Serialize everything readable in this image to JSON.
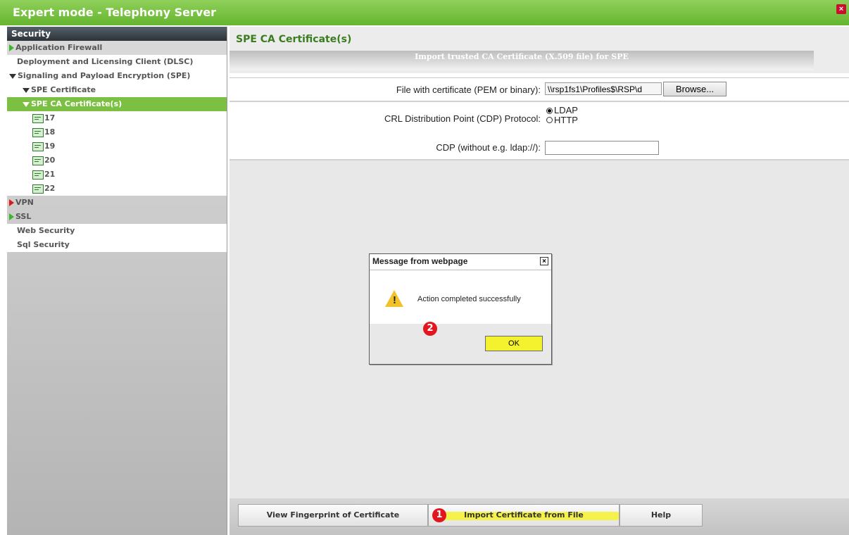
{
  "window": {
    "title": "Expert mode - Telephony Server",
    "close_glyph": "×"
  },
  "sidebar": {
    "header": "Security",
    "items": [
      {
        "label": "Application Firewall",
        "icon": "play-green-icon"
      },
      {
        "label": "Deployment and Licensing Client (DLSC)",
        "icon": ""
      },
      {
        "label": "Signaling and Payload Encryption (SPE)",
        "icon": "triangle-down-icon"
      },
      {
        "label": "SPE Certificate",
        "icon": "triangle-down-icon"
      },
      {
        "label": "SPE CA Certificate(s)",
        "icon": "triangle-down-icon",
        "selected": true
      },
      {
        "label": "17",
        "icon": "certificate-icon"
      },
      {
        "label": "18",
        "icon": "certificate-icon"
      },
      {
        "label": "19",
        "icon": "certificate-icon"
      },
      {
        "label": "20",
        "icon": "certificate-icon"
      },
      {
        "label": "21",
        "icon": "certificate-icon"
      },
      {
        "label": "22",
        "icon": "certificate-icon"
      },
      {
        "label": "VPN",
        "icon": "play-red-icon"
      },
      {
        "label": "SSL",
        "icon": "play-green-icon"
      },
      {
        "label": "Web Security",
        "icon": ""
      },
      {
        "label": "Sql Security",
        "icon": ""
      }
    ]
  },
  "main": {
    "title": "SPE CA Certificate(s)",
    "import_bar": "Import trusted CA Certificate (X.509 file) for SPE",
    "file_label": "File with certificate (PEM or binary):",
    "file_value": "\\\\rsp1fs1\\Profiles$\\RSP\\d",
    "browse_label": "Browse...",
    "crl_label": "CRL Distribution Point (CDP) Protocol:",
    "radio_ldap": "LDAP",
    "radio_http": "HTTP",
    "cdp_label": "CDP (without e.g. ldap://):",
    "cdp_value": ""
  },
  "footer": {
    "btn_fingerprint": "View Fingerprint of Certificate",
    "btn_import": "Import Certificate from File",
    "btn_help": "Help"
  },
  "dialog": {
    "title": "Message from webpage",
    "message": "Action completed successfully",
    "ok_label": "OK",
    "warn_glyph": "!",
    "close_glyph": "×"
  },
  "badges": {
    "step1": "1",
    "step2": "2"
  },
  "colors": {
    "title_green": "#66b52f",
    "selected_green": "#7bc043",
    "highlight_yellow": "#f4f22e",
    "badge_red": "#e1161e"
  }
}
